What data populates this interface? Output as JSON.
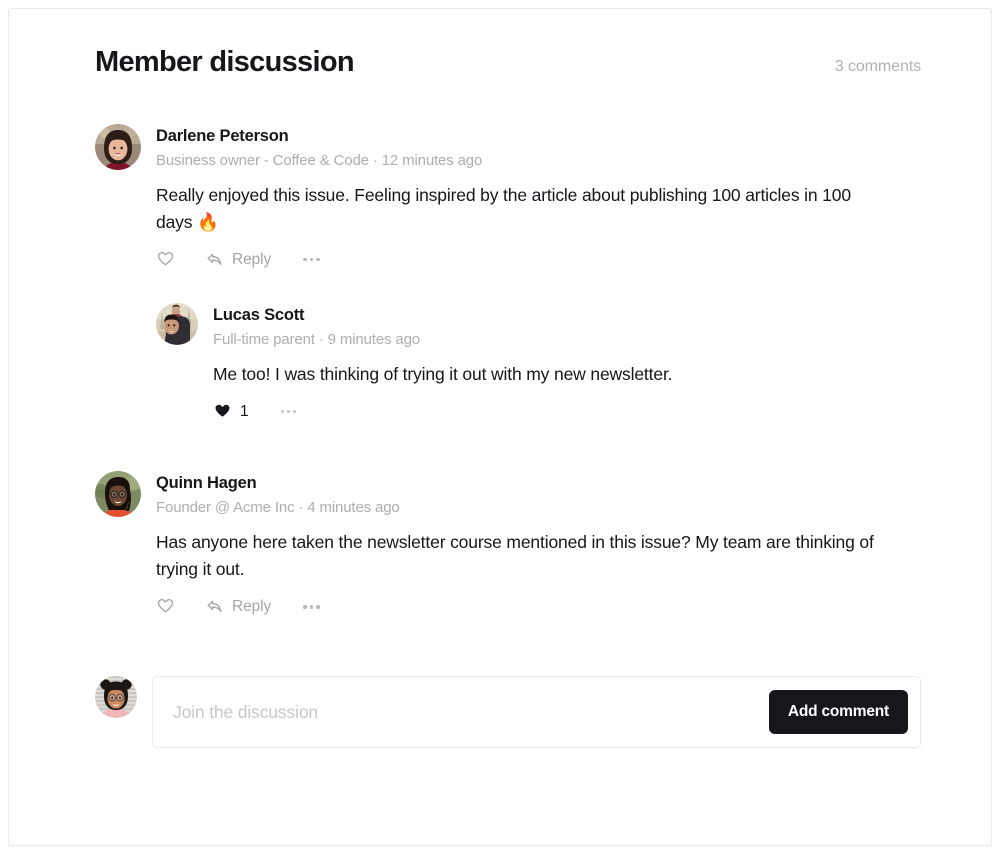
{
  "header": {
    "title": "Member discussion",
    "count_label": "3 comments"
  },
  "comments": [
    {
      "name": "Darlene Peterson",
      "meta": "Business owner - Coffee & Code · 12 minutes ago",
      "body": "Really enjoyed this issue. Feeling inspired by the article about publishing 100 articles in 100 days 🔥",
      "avatar": "woman-dark-hair-maroon-top",
      "actions": {
        "like_icon": "heart-outline-icon",
        "reply_icon": "reply-arrow-icon",
        "reply_label": "Reply",
        "more_icon": "ellipsis-icon"
      },
      "replies": [
        {
          "name": "Lucas Scott",
          "meta": "Full-time parent · 9 minutes ago",
          "body": "Me too! I was thinking of trying it out with my new newsletter.",
          "avatar": "man-with-child-on-shoulders",
          "actions": {
            "like_icon": "heart-filled-icon",
            "like_count": "1",
            "more_icon": "ellipsis-icon"
          }
        }
      ]
    },
    {
      "name": "Quinn Hagen",
      "meta": "Founder @ Acme Inc · 4 minutes ago",
      "body": "Has anyone here taken the newsletter course mentioned in this issue? My team are thinking of trying it out.",
      "avatar": "person-glasses-locs-orange-top",
      "actions": {
        "like_icon": "heart-outline-icon",
        "reply_icon": "reply-arrow-icon",
        "reply_label": "Reply",
        "more_icon": "ellipsis-icon"
      },
      "replies": []
    }
  ],
  "form": {
    "avatar": "person-buns-glasses-pink-top",
    "placeholder": "Join the discussion",
    "submit_label": "Add comment"
  },
  "colors": {
    "text": "#15171a",
    "muted": "#aeaeb2",
    "button_bg": "#15171a",
    "button_text": "#ffffff",
    "border": "#ebebeb"
  }
}
